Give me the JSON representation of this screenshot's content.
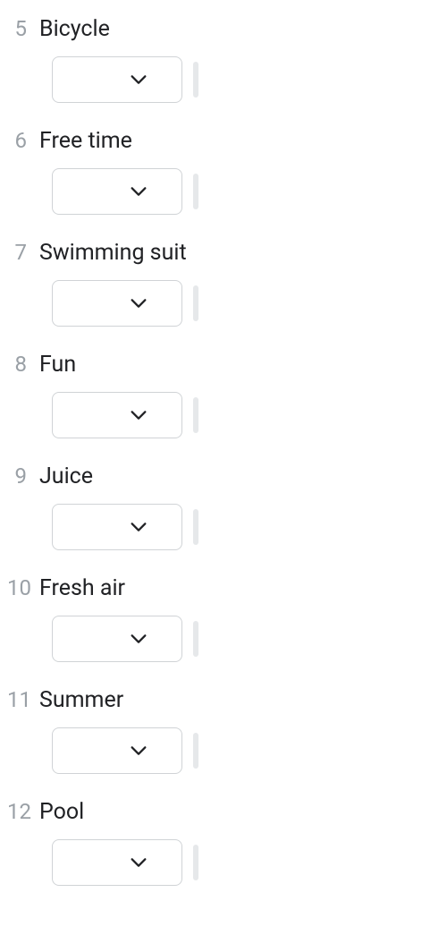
{
  "questions": [
    {
      "number": "5",
      "label": "Bicycle"
    },
    {
      "number": "6",
      "label": "Free time"
    },
    {
      "number": "7",
      "label": "Swimming suit"
    },
    {
      "number": "8",
      "label": "Fun"
    },
    {
      "number": "9",
      "label": "Juice"
    },
    {
      "number": "10",
      "label": "Fresh air"
    },
    {
      "number": "11",
      "label": "Summer"
    },
    {
      "number": "12",
      "label": "Pool"
    }
  ]
}
